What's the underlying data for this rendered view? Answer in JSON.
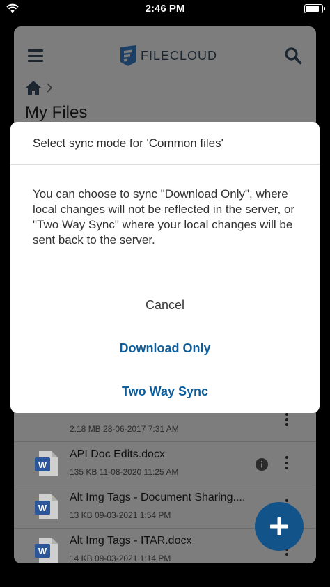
{
  "status_bar": {
    "time": "2:46 PM",
    "battery_level": 0.85
  },
  "header": {
    "logo_text": "FILECLOUD",
    "menu_icon": "hamburger-menu-icon",
    "search_icon": "search-icon"
  },
  "breadcrumb": {
    "home_icon": "home-icon",
    "separator_icon": "chevron-right-icon"
  },
  "page_title": "My Files",
  "files": [
    {
      "name": "",
      "meta": "2.18 MB 28-06-2017 7:31 AM",
      "type": "image"
    },
    {
      "name": "API Doc Edits.docx",
      "meta": "135 KB 11-08-2020 11:25 AM",
      "type": "word"
    },
    {
      "name": "Alt Img Tags - Document Sharing....",
      "meta": "13 KB 09-03-2021 1:54 PM",
      "type": "word"
    },
    {
      "name": "Alt Img Tags - ITAR.docx",
      "meta": "14 KB 09-03-2021 1:14 PM",
      "type": "word"
    }
  ],
  "doc_icon_letter": "W",
  "colors": {
    "accent": "#0f5e9c",
    "fab": "#12538a",
    "word": "#2b579a",
    "overlay": "#7d7d7d"
  },
  "dialog": {
    "title": "Select sync mode for 'Common files'",
    "body": "You can choose to sync \"Download Only\", where local changes will not be reflected in the server, or \"Two Way Sync\" where your local changes will be sent back to the server.",
    "cancel_label": "Cancel",
    "download_only_label": "Download Only",
    "two_way_label": "Two Way Sync"
  }
}
